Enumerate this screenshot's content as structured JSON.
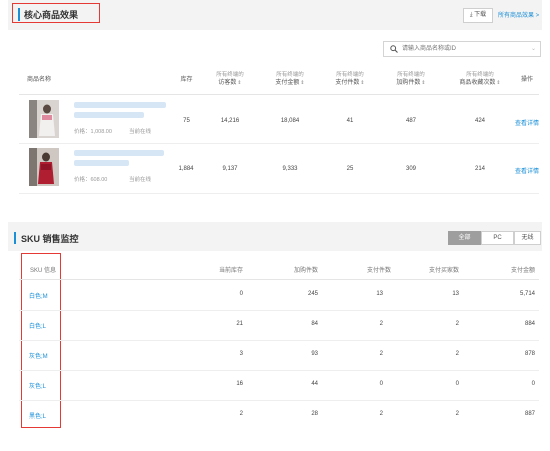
{
  "core": {
    "title": "核心商品效果",
    "download_label": "下载",
    "all_products_link": "所有商品效果 >",
    "search_placeholder": "请输入商品名称或ID",
    "columns": [
      {
        "sub": "",
        "main": "商品名称",
        "sortable": false
      },
      {
        "sub": "",
        "main": "库存",
        "sortable": false
      },
      {
        "sub": "所有终端的",
        "main": "访客数",
        "sortable": true
      },
      {
        "sub": "所有终端的",
        "main": "支付金额",
        "sortable": true
      },
      {
        "sub": "所有终端的",
        "main": "支付件数",
        "sortable": true
      },
      {
        "sub": "所有终端的",
        "main": "加购件数",
        "sortable": true
      },
      {
        "sub": "所有终端的",
        "main": "商品收藏次数",
        "sortable": true
      },
      {
        "sub": "",
        "main": "操作",
        "sortable": false
      }
    ],
    "rows": [
      {
        "price": "价格：1,008.00",
        "status": "当前在线",
        "stock": "75",
        "visitors": "14,216",
        "pay_amount": "18,084",
        "pay_qty": "41",
        "cart_qty": "487",
        "favorites": "424",
        "action": "查看详情"
      },
      {
        "price": "价格：608.00",
        "status": "当前在线",
        "stock": "1,884",
        "visitors": "9,137",
        "pay_amount": "9,333",
        "pay_qty": "25",
        "cart_qty": "309",
        "favorites": "214",
        "action": "查看详情"
      }
    ]
  },
  "sku": {
    "title": "SKU 销售监控",
    "segments": [
      {
        "label": "全部",
        "active": true
      },
      {
        "label": "PC",
        "active": false
      },
      {
        "label": "无线",
        "active": false
      }
    ],
    "columns": [
      "SKU 信息",
      "当前库存",
      "加购件数",
      "支付件数",
      "支付买家数",
      "支付金额"
    ],
    "rows": [
      {
        "name": "白色;M",
        "stock": "0",
        "cart": "245",
        "pay_qty": "13",
        "buyers": "13",
        "amount": "5,714"
      },
      {
        "name": "白色;L",
        "stock": "21",
        "cart": "84",
        "pay_qty": "2",
        "buyers": "2",
        "amount": "884"
      },
      {
        "name": "灰色;M",
        "stock": "3",
        "cart": "93",
        "pay_qty": "2",
        "buyers": "2",
        "amount": "878"
      },
      {
        "name": "灰色;L",
        "stock": "16",
        "cart": "44",
        "pay_qty": "0",
        "buyers": "0",
        "amount": "0"
      },
      {
        "name": "黑色;L",
        "stock": "2",
        "cart": "28",
        "pay_qty": "2",
        "buyers": "2",
        "amount": "887"
      }
    ]
  },
  "colors": {
    "accent": "#1a8fd8",
    "highlight_box": "#e53935",
    "active_segment": "#9e9e9e"
  }
}
